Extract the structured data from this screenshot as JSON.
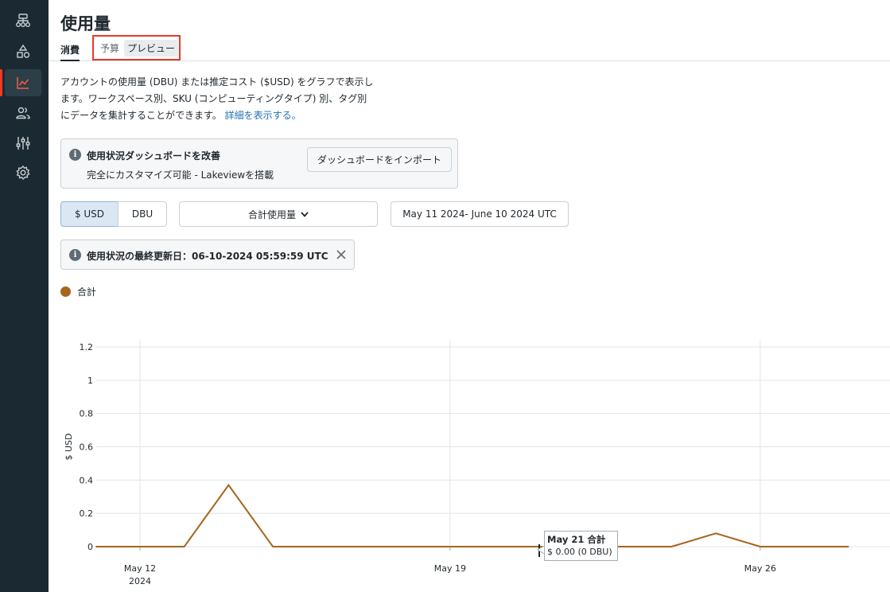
{
  "page": {
    "title": "使用量"
  },
  "tabs": {
    "consumption": "消費",
    "budget": "予算",
    "preview_badge": "プレビュー"
  },
  "description": {
    "line1": "アカウントの使用量 (DBU) または推定コスト ($USD) をグラフで表示し",
    "line2": "ます。ワークスペース別、SKU (コンピューティングタイプ) 別、タグ別",
    "line3": "にデータを集計することができます。",
    "link": "詳細を表示する。"
  },
  "callout": {
    "title": "使用状況ダッシュボードを改善",
    "subtitle": "完全にカスタマイズ可能 - Lakeviewを搭載",
    "import_button": "ダッシュボードをインポート"
  },
  "controls": {
    "usd_label": "$ USD",
    "dbu_label": "DBU",
    "aggregate_label": "合計使用量",
    "date_range": "May 11 2024- June 10 2024 UTC"
  },
  "notice": {
    "text": "使用状況の最終更新日：06-10-2024 05:59:59 UTC"
  },
  "legend": {
    "total": "合計"
  },
  "tooltip": {
    "title": "May 21 合計",
    "value": "$ 0.00 (0 DBU)"
  },
  "colors": {
    "series": "#a5661d",
    "accent": "#ff3621",
    "link": "#2272b4",
    "sidebar": "#1b2a32"
  },
  "chart_data": {
    "type": "line",
    "ylabel": "$ USD",
    "ylim": [
      0,
      1.2
    ],
    "yticks": [
      0,
      0.2,
      0.4,
      0.6,
      0.8,
      1,
      1.2
    ],
    "xticks": [
      {
        "label": "May 12",
        "sub": "2024",
        "day": 12
      },
      {
        "label": "May 19",
        "sub": "",
        "day": 19
      },
      {
        "label": "May 26",
        "sub": "",
        "day": 26
      }
    ],
    "series": [
      {
        "name": "合計",
        "days": [
          11,
          12,
          13,
          14,
          15,
          16,
          17,
          18,
          19,
          20,
          21,
          22,
          23,
          24,
          25,
          26,
          27,
          28
        ],
        "values": [
          0,
          0,
          0,
          0.37,
          0,
          0,
          0,
          0,
          0,
          0,
          0,
          0,
          0,
          0,
          0.08,
          0,
          0,
          0
        ]
      }
    ]
  }
}
